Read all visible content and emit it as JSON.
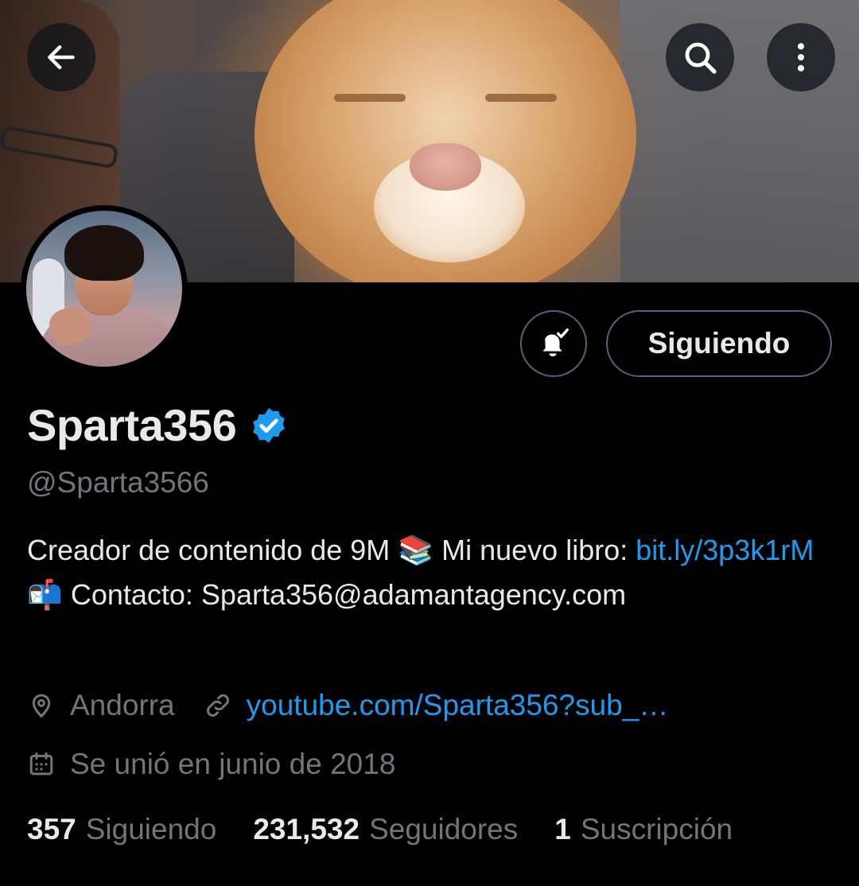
{
  "header": {
    "back_icon": "arrow-left-icon",
    "search_icon": "search-icon",
    "more_icon": "more-vertical-icon"
  },
  "profile": {
    "display_name": "Sparta356",
    "handle": "@Sparta3566",
    "verified": true,
    "follow_button_label": "Siguiendo",
    "notification_icon": "bell-check-icon",
    "bio": {
      "text_1": "Creador de contenido de 9M 📚 Mi nuevo libro: ",
      "link_1": "bit.ly/3p3k1rM",
      "text_2": " 📬 Contacto: Sparta356@adamantagency.com"
    },
    "location": "Andorra",
    "website": "youtube.com/Sparta356?sub_…",
    "joined": "Se unió en junio de 2018",
    "stats": {
      "following_count": "357",
      "following_label": "Siguiendo",
      "followers_count": "231,532",
      "followers_label": "Seguidores",
      "subscriptions_count": "1",
      "subscriptions_label": "Suscripción"
    }
  },
  "colors": {
    "accent": "#1d9bf0",
    "background": "#000000",
    "text_primary": "#e7e9ea",
    "text_secondary": "#71767b",
    "border": "#536471"
  }
}
